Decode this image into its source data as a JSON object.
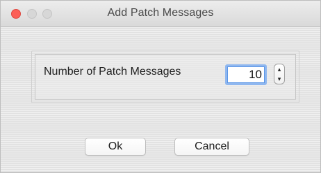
{
  "window": {
    "title": "Add Patch Messages"
  },
  "traffic_lights": {
    "close_color": "#fc5f57",
    "inactive_color": "#d7d7d7"
  },
  "form": {
    "label": "Number of Patch Messages",
    "value": "10",
    "stepper_up": "▴",
    "stepper_down": "▾",
    "focus_color": "#8fb7ef"
  },
  "buttons": {
    "ok": "Ok",
    "cancel": "Cancel"
  }
}
